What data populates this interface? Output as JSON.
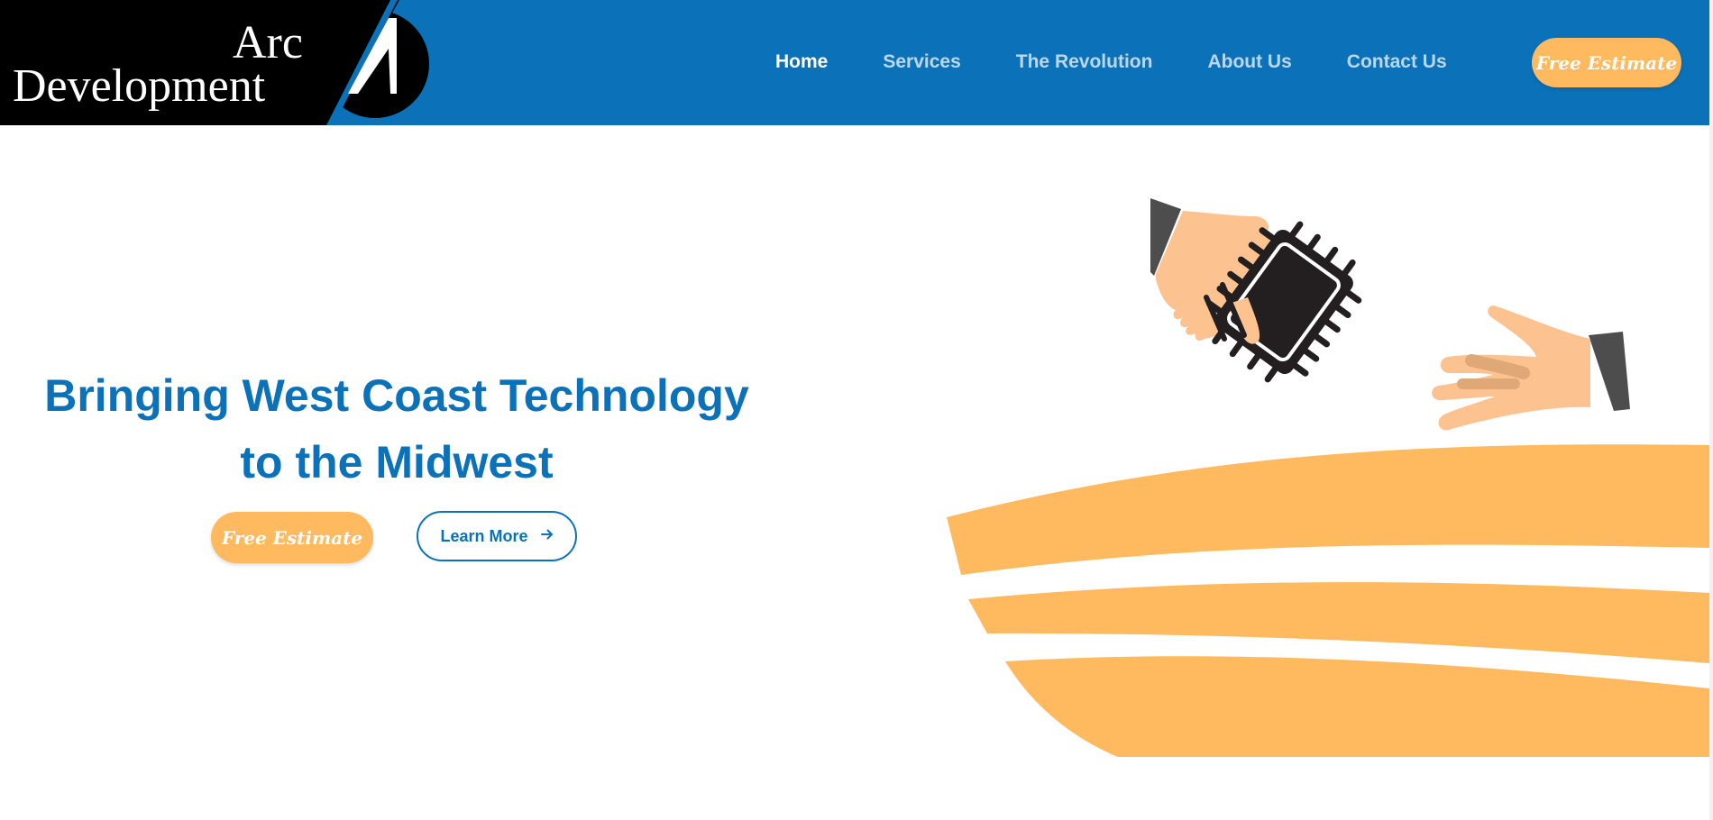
{
  "brand": {
    "line1": "Arc",
    "line2": "Development"
  },
  "nav": {
    "tabs": [
      {
        "label": "Home",
        "active": true
      },
      {
        "label": "Services",
        "active": false
      },
      {
        "label": "The Revolution",
        "active": false
      },
      {
        "label": "About Us",
        "active": false
      },
      {
        "label": "Contact Us",
        "active": false
      }
    ],
    "estimate_label": "Free Estimate"
  },
  "hero": {
    "title_line1": "Bringing West Coast Technology",
    "title_line2": "to the Midwest",
    "estimate_label": "Free Estimate",
    "learn_more_label": "Learn More",
    "learn_more_icon": "arrow-right-icon",
    "illustration": "hands-passing-microchip"
  },
  "colors": {
    "primary_blue": "#0B72B9",
    "accent_orange": "#FFBA60",
    "skin": "#FCC391",
    "sleeve": "#4D4D4D",
    "chip": "#231F20"
  }
}
